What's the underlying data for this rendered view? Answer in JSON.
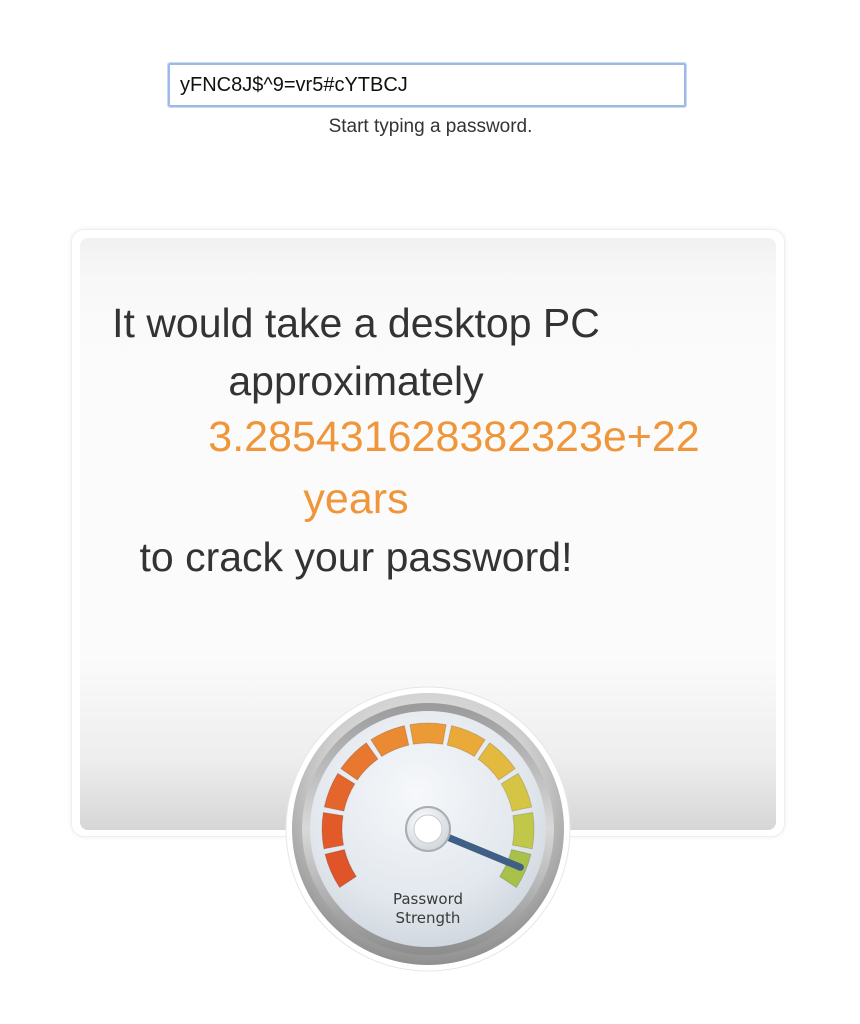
{
  "password_field": {
    "value": "yFNC8J$^9=vr5#cYTBCJ"
  },
  "hint": "Start typing a password.",
  "result": {
    "line1": "It would take a desktop PC",
    "line2": "approximately",
    "time_value": "3.285431628382323e+22",
    "time_unit": "years",
    "line5": "to crack your password!"
  },
  "gauge": {
    "label_line1": "Password",
    "label_line2": "Strength",
    "icon": "gauge-icon",
    "strength_fraction": 0.95
  },
  "colors": {
    "accent": "#f0963a",
    "text": "#333333",
    "input_border": "#9bbbe6"
  }
}
